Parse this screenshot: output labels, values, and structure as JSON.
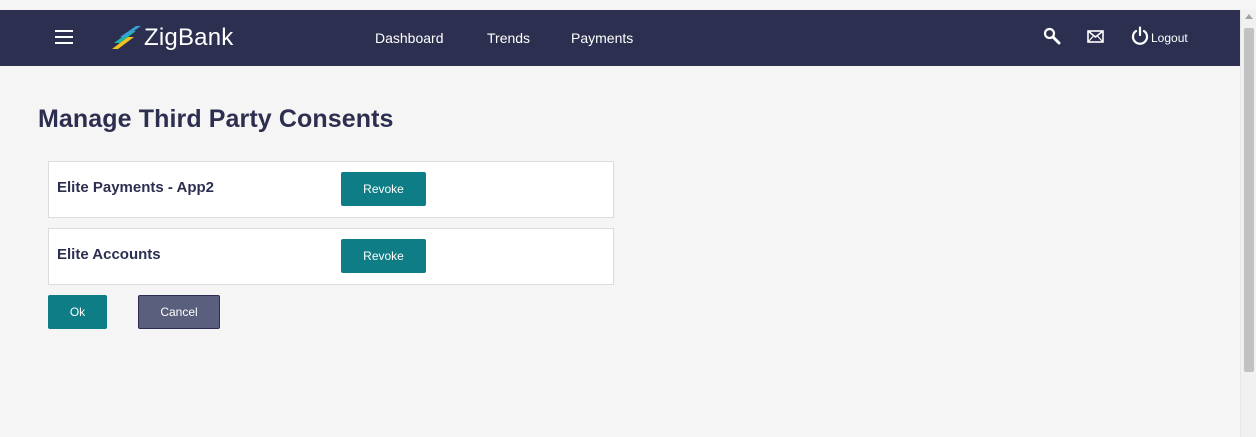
{
  "header": {
    "brand_name": "ZigBank",
    "nav_items": [
      {
        "label": "Dashboard"
      },
      {
        "label": "Trends"
      },
      {
        "label": "Payments"
      }
    ],
    "icons": {
      "menu": "hamburger-menu-icon",
      "logo": "zigbank-logo-icon",
      "search": "search-icon",
      "mail": "mail-icon",
      "logout": "power-icon"
    },
    "logout_label": "Logout"
  },
  "main": {
    "title": "Manage Third Party Consents",
    "consents": [
      {
        "name": "Elite Payments - App2",
        "action_label": "Revoke"
      },
      {
        "name": "Elite Accounts",
        "action_label": "Revoke"
      }
    ],
    "ok_label": "Ok",
    "cancel_label": "Cancel"
  },
  "colors": {
    "header_bg": "#2c2f4f",
    "primary_button": "#0e7d85",
    "secondary_button": "#5a5f7d",
    "title_text": "#2c2f4f",
    "page_bg": "#f5f5f5",
    "logo_accent_teal": "#1fb5a8",
    "logo_accent_yellow": "#f2c21a"
  }
}
